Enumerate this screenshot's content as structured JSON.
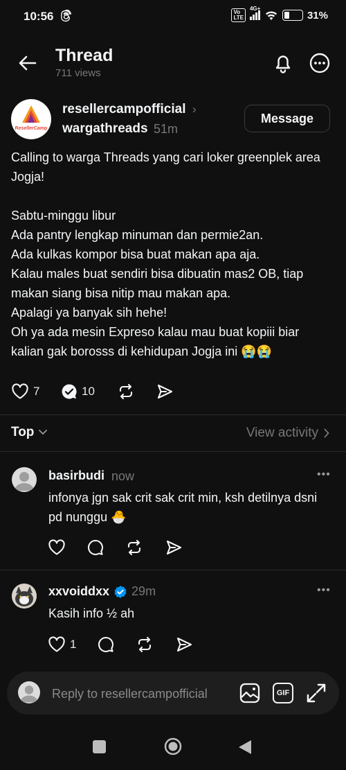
{
  "status_bar": {
    "time": "10:56",
    "network": "4G+",
    "volte": "Vo LTE",
    "battery": "31%",
    "battery_level": 0.31
  },
  "header": {
    "title": "Thread",
    "views": "711 views"
  },
  "post": {
    "author": "resellercampofficial",
    "author_chevron": "›",
    "sub_author": "wargathreads",
    "time": "51m",
    "message_button": "Message",
    "avatar_logo_text": "ResellerCamp",
    "text": "Calling to warga Threads yang cari loker greenplek area Jogja!\n\nSabtu-minggu libur\nAda pantry lengkap minuman dan permie2an.\nAda kulkas kompor bisa buat makan apa aja.\nKalau males buat sendiri bisa dibuatin mas2 OB, tiap makan siang bisa nitip mau makan apa.\nApalagi ya banyak sih hehe!\nOh ya ada mesin Expreso kalau mau buat kopiii biar kalian gak borosss di kehidupan Jogja ini 😭😭",
    "likes": "7",
    "replies": "10"
  },
  "sort": {
    "label": "Top",
    "view_activity": "View activity"
  },
  "comments": [
    {
      "user": "basirbudi",
      "time": "now",
      "text": "infonya jgn sak crit sak crit min, ksh detilnya dsni pd nunggu 🐣",
      "likes": ""
    },
    {
      "user": "xxvoiddxx",
      "time": "29m",
      "text": "Kasih info ½ ah",
      "likes": "1",
      "verified": true
    }
  ],
  "reply_bar": {
    "placeholder": "Reply to resellercampofficial",
    "gif_label": "GIF"
  },
  "colors": {
    "background": "#101010",
    "text": "#f3f5f7",
    "secondary": "#777777",
    "verified": "#0095f6"
  }
}
